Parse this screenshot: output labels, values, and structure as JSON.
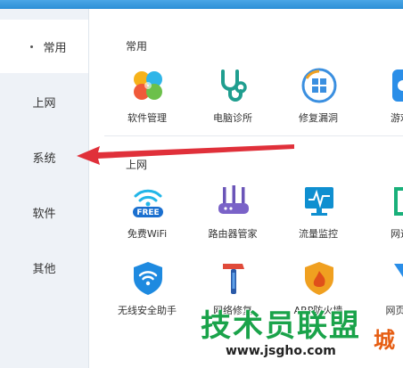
{
  "sidebar": {
    "items": [
      {
        "label": "常用"
      },
      {
        "label": "上网"
      },
      {
        "label": "系统"
      },
      {
        "label": "软件"
      },
      {
        "label": "其他"
      }
    ]
  },
  "sections": [
    {
      "title": "常用",
      "tools": [
        {
          "label": "软件管理",
          "icon": "clover-icon"
        },
        {
          "label": "电脑诊所",
          "icon": "stethoscope-icon"
        },
        {
          "label": "修复漏洞",
          "icon": "windows-repair-icon"
        },
        {
          "label": "游戏",
          "icon": "game-icon"
        }
      ]
    },
    {
      "title": "上网",
      "tools": [
        {
          "label": "免费WiFi",
          "icon": "wifi-free-icon",
          "badge": "FREE"
        },
        {
          "label": "路由器管家",
          "icon": "router-icon"
        },
        {
          "label": "流量监控",
          "icon": "monitor-icon"
        },
        {
          "label": "网速",
          "icon": "speed-icon"
        }
      ]
    },
    {
      "title": "",
      "tools": [
        {
          "label": "无线安全助手",
          "icon": "wifi-shield-icon"
        },
        {
          "label": "网络修复",
          "icon": "hammer-icon"
        },
        {
          "label": "ARP防火墙",
          "icon": "firewall-icon"
        },
        {
          "label": "网页广",
          "icon": "funnel-icon"
        }
      ]
    }
  ],
  "watermark": {
    "main": "技术员联盟",
    "url": "www.jsgho.com",
    "suffix": "城"
  },
  "colors": {
    "arrow": "#e0303a",
    "sidebar_bg": "#eef2f7",
    "accent_blue": "#1e8ae0"
  }
}
